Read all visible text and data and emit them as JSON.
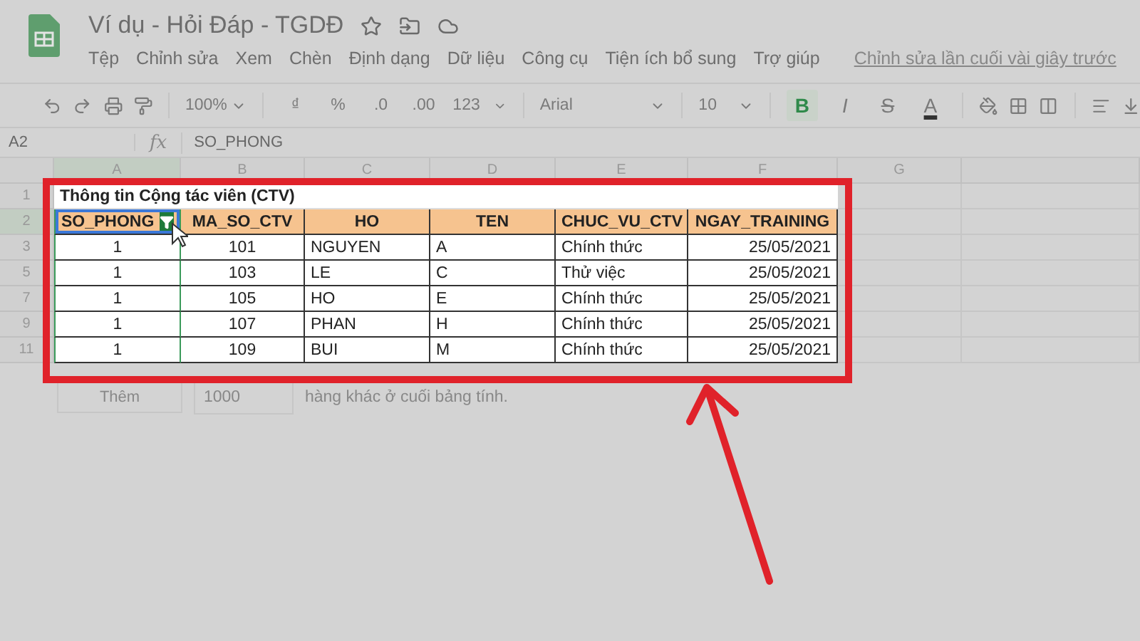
{
  "document": {
    "title": "Ví dụ - Hỏi Đáp - TGDĐ",
    "menu": [
      "Tệp",
      "Chỉnh sửa",
      "Xem",
      "Chèn",
      "Định dạng",
      "Dữ liệu",
      "Công cụ",
      "Tiện ích bổ sung",
      "Trợ giúp"
    ],
    "last_edit": "Chỉnh sửa lần cuối vài giây trước"
  },
  "toolbar": {
    "zoom": "100%",
    "number_formats": [
      "₫",
      "%",
      ".0",
      ".00",
      "123"
    ],
    "font": "Arial",
    "font_size": "10",
    "styles": [
      {
        "label": "B",
        "kind": "bold",
        "selected": true
      },
      {
        "label": "I",
        "kind": "italic",
        "selected": false
      },
      {
        "label": "S",
        "kind": "strike",
        "selected": false
      },
      {
        "label": "A",
        "kind": "color",
        "selected": false
      }
    ]
  },
  "formula_bar": {
    "cell": "A2",
    "fx": "fx",
    "value": "SO_PHONG"
  },
  "columns": [
    {
      "label": "A",
      "selected": true
    },
    {
      "label": "B",
      "selected": false
    },
    {
      "label": "C",
      "selected": false
    },
    {
      "label": "D",
      "selected": false
    },
    {
      "label": "E",
      "selected": false
    },
    {
      "label": "F",
      "selected": false
    },
    {
      "label": "G",
      "selected": false
    }
  ],
  "sheet": {
    "title_row": {
      "number": "1",
      "text": "Thông tin Cộng tác viên (CTV)"
    },
    "header_row": {
      "number": "2",
      "selected": true,
      "cells": [
        "SO_PHONG",
        "MA_SO_CTV",
        "HO",
        "TEN",
        "CHUC_VU_CTV",
        "NGAY_TRAINING"
      ]
    },
    "rows": [
      {
        "number": "3",
        "cells": [
          "1",
          "101",
          "NGUYEN",
          "A",
          "Chính thức",
          "25/05/2021"
        ]
      },
      {
        "number": "5",
        "cells": [
          "1",
          "103",
          "LE",
          "C",
          "Thử việc",
          "25/05/2021"
        ]
      },
      {
        "number": "7",
        "cells": [
          "1",
          "105",
          "HO",
          "E",
          "Chính thức",
          "25/05/2021"
        ]
      },
      {
        "number": "9",
        "cells": [
          "1",
          "107",
          "PHAN",
          "H",
          "Chính thức",
          "25/05/2021"
        ]
      },
      {
        "number": "11",
        "cells": [
          "1",
          "109",
          "BUI",
          "M",
          "Chính thức",
          "25/05/2021"
        ]
      }
    ]
  },
  "add_rows": {
    "button": "Thêm",
    "count": "1000",
    "text": "hàng khác ở cuối bảng tính."
  }
}
